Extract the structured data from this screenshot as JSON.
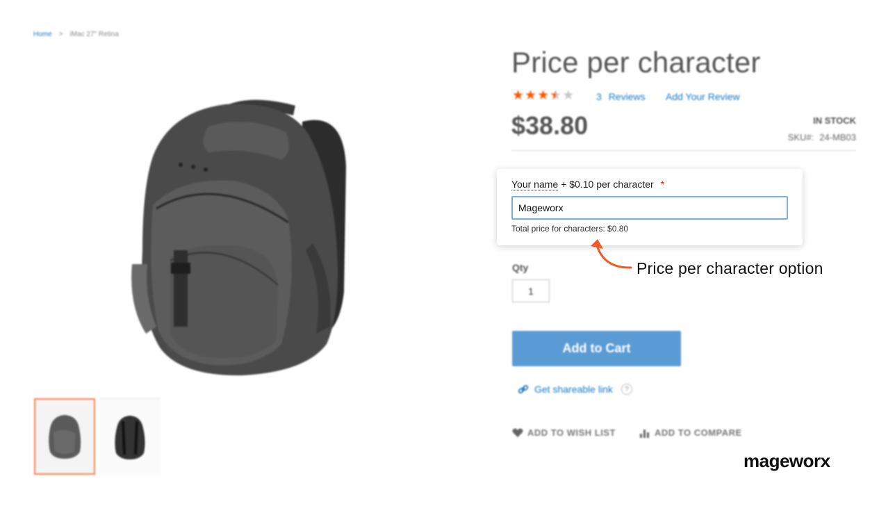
{
  "breadcrumb": {
    "home": "Home",
    "separator": ">",
    "current": "iMac 27\" Retina"
  },
  "product": {
    "title": "Price per character",
    "rating_stars": 3.5,
    "rating_max": 5,
    "reviews_count": "3",
    "reviews_label": "Reviews",
    "add_review": "Add Your Review",
    "price": "$38.80",
    "stock": "IN STOCK",
    "sku_label": "SKU#:",
    "sku_value": "24-MB03"
  },
  "option": {
    "label_name": "Your name",
    "label_price": "+ $0.10 per character",
    "required_mark": "*",
    "value": "Mageworx",
    "total_text": "Total price for characters: $0.80"
  },
  "annotation": {
    "text": "Price per character option",
    "color": "#f15a24"
  },
  "qty": {
    "label": "Qty",
    "value": "1"
  },
  "actions": {
    "add_to_cart": "Add to Cart",
    "share_link": "Get shareable link",
    "help": "?",
    "wish_list": "ADD TO WISH LIST",
    "compare": "ADD TO COMPARE"
  },
  "brand": {
    "logo": "mageworx"
  },
  "colors": {
    "link": "#1979c3",
    "star": "#ff5501",
    "cart_button": "#5b9bd5",
    "active_thumb_border": "#ff7f50",
    "required": "#e02b27"
  },
  "icons": [
    "backpack-image",
    "link-icon",
    "heart-icon",
    "compare-icon",
    "arrow-icon",
    "star-icon"
  ]
}
